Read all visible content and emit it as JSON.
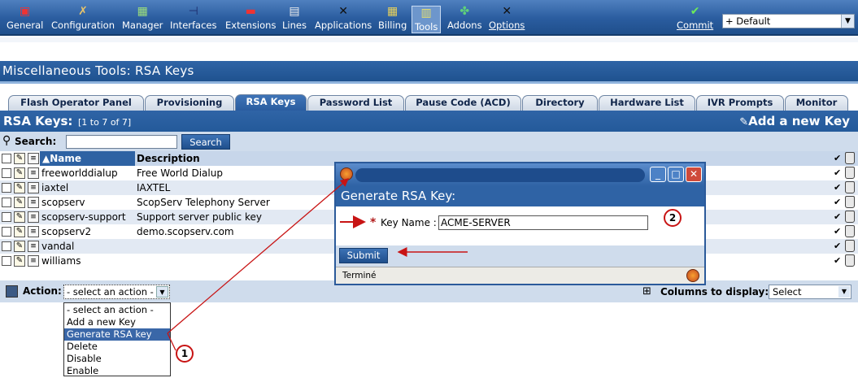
{
  "toolbar": {
    "items": [
      {
        "label": "General",
        "icon": "general-icon"
      },
      {
        "label": "Configuration",
        "icon": "wrench-icon"
      },
      {
        "label": "Manager",
        "icon": "manager-icon"
      },
      {
        "label": "Interfaces",
        "icon": "interfaces-icon"
      },
      {
        "label": "Extensions",
        "icon": "extensions-icon"
      },
      {
        "label": "Lines",
        "icon": "lines-icon"
      },
      {
        "label": "Applications",
        "icon": "applications-icon"
      },
      {
        "label": "Billing",
        "icon": "billing-icon"
      },
      {
        "label": "Tools",
        "icon": "tools-icon"
      },
      {
        "label": "Addons",
        "icon": "addons-icon"
      },
      {
        "label": "Options",
        "icon": "options-icon"
      }
    ],
    "commit_label": "Commit",
    "profile_select": "+ Default"
  },
  "page_title": "Miscellaneous Tools:  RSA Keys",
  "tabs": [
    "Flash Operator Panel",
    "Provisioning",
    "RSA Keys",
    "Password List",
    "Pause Code (ACD)",
    "Directory",
    "Hardware List",
    "IVR Prompts",
    "Monitor"
  ],
  "rsa": {
    "heading": "RSA Keys:",
    "count": "[1 to 7 of 7]",
    "add_key": "Add a new Key",
    "search_label": "Search:",
    "search_button": "Search",
    "columns": {
      "name": "Name",
      "description": "Description"
    },
    "rows": [
      {
        "name": "freeworlddialup",
        "description": "Free World Dialup"
      },
      {
        "name": "iaxtel",
        "description": "IAXTEL"
      },
      {
        "name": "scopserv",
        "description": "ScopServ Telephony Server"
      },
      {
        "name": "scopserv-support",
        "description": "Support server public key"
      },
      {
        "name": "scopserv2",
        "description": "demo.scopserv.com"
      },
      {
        "name": "vandal",
        "description": ""
      },
      {
        "name": "williams",
        "description": ""
      }
    ]
  },
  "action_bar": {
    "label": "Action:",
    "select_value": "- select an action -",
    "columns_label": "Columns to display:",
    "columns_value": "Select"
  },
  "action_options": [
    "- select an action -",
    "Add a new Key",
    "Generate RSA key",
    "Delete",
    "Disable",
    "Enable"
  ],
  "popup": {
    "heading": "Generate RSA Key:",
    "required_mark": "*",
    "key_label": "Key Name :",
    "key_value": "ACME-SERVER",
    "submit": "Submit",
    "status": "Terminé"
  },
  "annotations": {
    "one": "1",
    "two": "2"
  },
  "colors": {
    "accent": "#2f64a6",
    "annotation": "#c81414",
    "row_alt": "#e2e9f3"
  }
}
